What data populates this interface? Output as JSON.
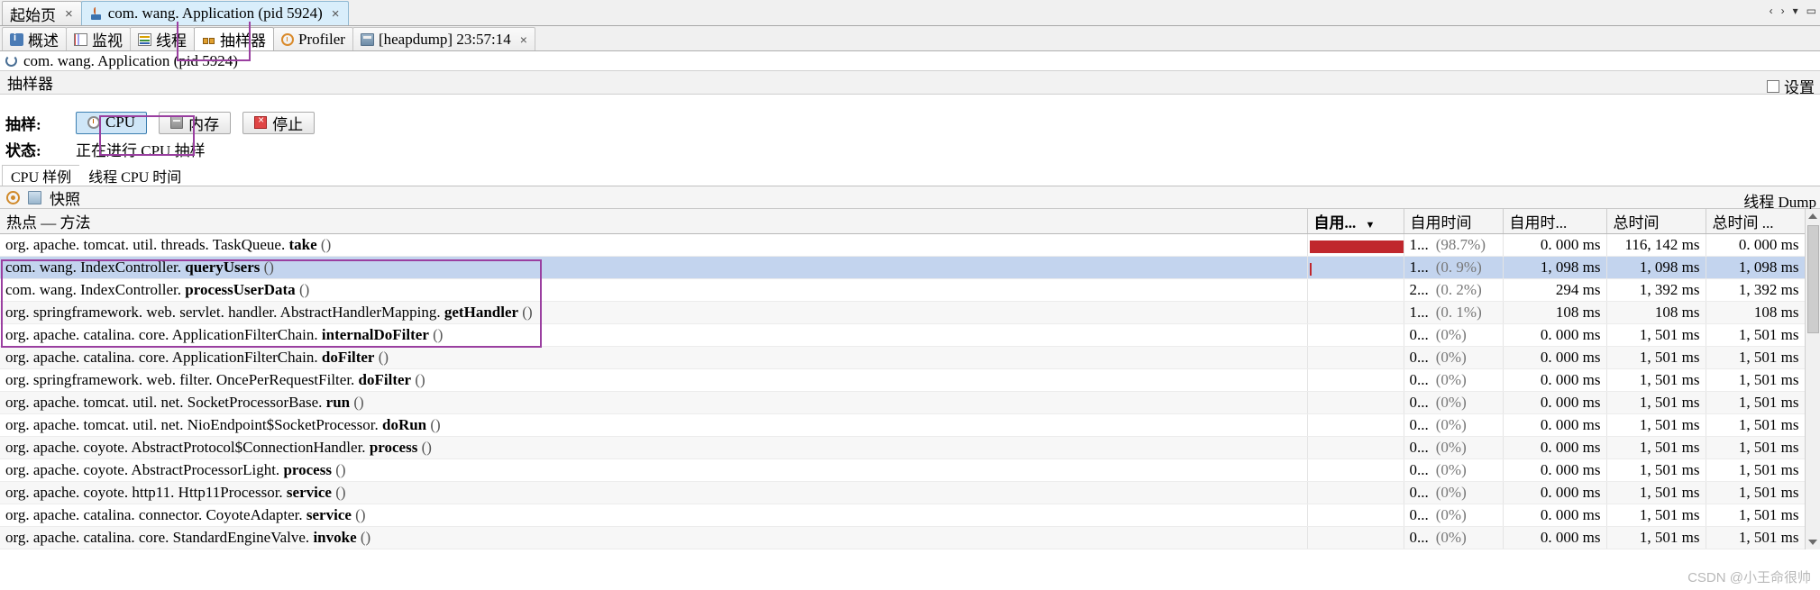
{
  "window": {
    "doc_tabs": [
      {
        "label": "起始页",
        "icon": "none",
        "active": false,
        "closable": true
      },
      {
        "label": "com. wang. Application  (pid 5924)",
        "icon": "java-icon",
        "active": true,
        "closable": true
      }
    ],
    "tabstrip_controls": [
      "‹",
      "›",
      "▾",
      "▭"
    ]
  },
  "view_tabs": [
    {
      "label": "概述",
      "icon": "overview-icon",
      "active": false
    },
    {
      "label": "监视",
      "icon": "monitor-icon",
      "active": false
    },
    {
      "label": "线程",
      "icon": "thread-icon",
      "active": false
    },
    {
      "label": "抽样器",
      "icon": "sampler-icon",
      "active": true
    },
    {
      "label": "Profiler",
      "icon": "profiler-icon",
      "active": false
    },
    {
      "label": "[heapdump] 23:57:14",
      "icon": "heapdump-icon",
      "active": false,
      "closable": true
    }
  ],
  "process_header": {
    "icon": "process-circle-icon",
    "title": "com. wang. Application  (pid 5924)"
  },
  "sampler": {
    "panel_title": "抽样器",
    "settings_label": "设置",
    "sample_label": "抽样:",
    "status_label": "状态:",
    "status_value": "正在进行 CPU 抽样",
    "buttons": [
      {
        "label": "CPU",
        "icon": "cpu-icon",
        "active": true
      },
      {
        "label": "内存",
        "icon": "memory-icon",
        "active": false
      },
      {
        "label": "停止",
        "icon": "stop-icon",
        "active": false
      }
    ]
  },
  "inner_tabs": [
    {
      "label": "CPU 样例",
      "active": true
    },
    {
      "label": "线程 CPU 时间",
      "active": false
    }
  ],
  "snapshot_toolbar": {
    "snapshot_label": "快照",
    "icons": [
      "record-icon",
      "snapshot-icon"
    ],
    "right_label": "线程 Dump"
  },
  "table": {
    "columns": [
      {
        "label": "热点 — 方法",
        "key": "method",
        "align": "left"
      },
      {
        "label": "自用...",
        "key": "bar",
        "align": "left",
        "sorted": true,
        "sort_dir": "desc"
      },
      {
        "label": "自用时间",
        "key": "self_pct",
        "align": "left"
      },
      {
        "label": "自用时...",
        "key": "self_time",
        "align": "right"
      },
      {
        "label": "总时间",
        "key": "total_time",
        "align": "right"
      },
      {
        "label": "总时间 ...",
        "key": "total_time2",
        "align": "right"
      }
    ],
    "rows": [
      {
        "pkg": "org. apache. tomcat. util. threads. TaskQueue.",
        "method": "take",
        "args": "()",
        "bar": 100,
        "self_pct_num": "1...",
        "self_pct": "(98.7%)",
        "self_time": "0. 000 ms",
        "total_time": "116, 142 ms",
        "total_time2": "0. 000 ms",
        "selected": false
      },
      {
        "pkg": "com. wang. IndexController.",
        "method": "queryUsers",
        "args": "()",
        "bar": 1,
        "self_pct_num": "1...",
        "self_pct": "(0. 9%)",
        "self_time": "1, 098 ms",
        "total_time": "1, 098 ms",
        "total_time2": "1, 098 ms",
        "selected": true
      },
      {
        "pkg": "com. wang. IndexController.",
        "method": "processUserData",
        "args": "()",
        "bar": 0,
        "self_pct_num": "2...",
        "self_pct": "(0. 2%)",
        "self_time": "294 ms",
        "total_time": "1, 392 ms",
        "total_time2": "1, 392 ms",
        "selected": false
      },
      {
        "pkg": "org. springframework. web. servlet. handler. AbstractHandlerMapping.",
        "method": "getHandler",
        "args": "()",
        "bar": 0,
        "self_pct_num": "1...",
        "self_pct": "(0. 1%)",
        "self_time": "108 ms",
        "total_time": "108 ms",
        "total_time2": "108 ms",
        "selected": false
      },
      {
        "pkg": "org. apache. catalina. core. ApplicationFilterChain.",
        "method": "internalDoFilter",
        "args": "()",
        "bar": 0,
        "self_pct_num": "0...",
        "self_pct": "(0%)",
        "self_time": "0. 000 ms",
        "total_time": "1, 501 ms",
        "total_time2": "1, 501 ms",
        "selected": false
      },
      {
        "pkg": "org. apache. catalina. core. ApplicationFilterChain.",
        "method": "doFilter",
        "args": "()",
        "bar": 0,
        "self_pct_num": "0...",
        "self_pct": "(0%)",
        "self_time": "0. 000 ms",
        "total_time": "1, 501 ms",
        "total_time2": "1, 501 ms",
        "selected": false
      },
      {
        "pkg": "org. springframework. web. filter. OncePerRequestFilter.",
        "method": "doFilter",
        "args": "()",
        "bar": 0,
        "self_pct_num": "0...",
        "self_pct": "(0%)",
        "self_time": "0. 000 ms",
        "total_time": "1, 501 ms",
        "total_time2": "1, 501 ms",
        "selected": false
      },
      {
        "pkg": "org. apache. tomcat. util. net. SocketProcessorBase.",
        "method": "run",
        "args": "()",
        "bar": 0,
        "self_pct_num": "0...",
        "self_pct": "(0%)",
        "self_time": "0. 000 ms",
        "total_time": "1, 501 ms",
        "total_time2": "1, 501 ms",
        "selected": false
      },
      {
        "pkg": "org. apache. tomcat. util. net. NioEndpoint$SocketProcessor.",
        "method": "doRun",
        "args": "()",
        "bar": 0,
        "self_pct_num": "0...",
        "self_pct": "(0%)",
        "self_time": "0. 000 ms",
        "total_time": "1, 501 ms",
        "total_time2": "1, 501 ms",
        "selected": false
      },
      {
        "pkg": "org. apache. coyote. AbstractProtocol$ConnectionHandler.",
        "method": "process",
        "args": "()",
        "bar": 0,
        "self_pct_num": "0...",
        "self_pct": "(0%)",
        "self_time": "0. 000 ms",
        "total_time": "1, 501 ms",
        "total_time2": "1, 501 ms",
        "selected": false
      },
      {
        "pkg": "org. apache. coyote. AbstractProcessorLight.",
        "method": "process",
        "args": "()",
        "bar": 0,
        "self_pct_num": "0...",
        "self_pct": "(0%)",
        "self_time": "0. 000 ms",
        "total_time": "1, 501 ms",
        "total_time2": "1, 501 ms",
        "selected": false
      },
      {
        "pkg": "org. apache. coyote. http11. Http11Processor.",
        "method": "service",
        "args": "()",
        "bar": 0,
        "self_pct_num": "0...",
        "self_pct": "(0%)",
        "self_time": "0. 000 ms",
        "total_time": "1, 501 ms",
        "total_time2": "1, 501 ms",
        "selected": false
      },
      {
        "pkg": "org. apache. catalina. connector. CoyoteAdapter.",
        "method": "service",
        "args": "()",
        "bar": 0,
        "self_pct_num": "0...",
        "self_pct": "(0%)",
        "self_time": "0. 000 ms",
        "total_time": "1, 501 ms",
        "total_time2": "1, 501 ms",
        "selected": false
      },
      {
        "pkg": "org. apache. catalina. core. StandardEngineValve.",
        "method": "invoke",
        "args": "()",
        "bar": 0,
        "self_pct_num": "0...",
        "self_pct": "(0%)",
        "self_time": "0. 000 ms",
        "total_time": "1, 501 ms",
        "total_time2": "1, 501 ms",
        "selected": false
      }
    ]
  },
  "watermark": "CSDN @小王命很帅",
  "colors": {
    "accent": "#c0272d",
    "selection": "#c3d4ee",
    "annotation": "#9a3fa0",
    "active_tab": "#d9eefb"
  }
}
